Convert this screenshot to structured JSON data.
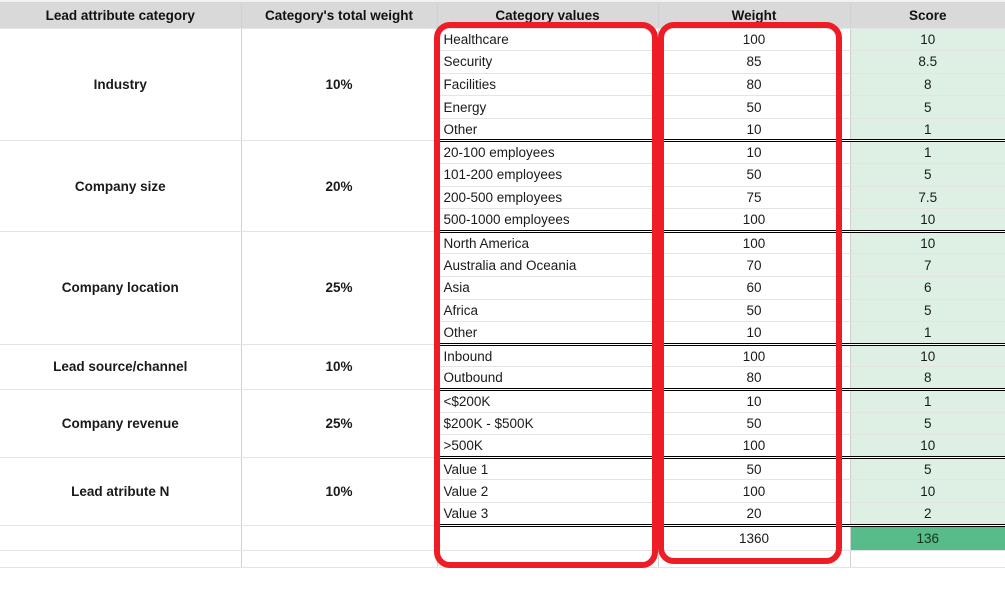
{
  "table": {
    "columns": [
      {
        "key": "category",
        "label": "Lead attribute category"
      },
      {
        "key": "weight_pct",
        "label": "Category's total weight"
      },
      {
        "key": "values",
        "label": "Category values"
      },
      {
        "key": "weight",
        "label": "Weight"
      },
      {
        "key": "score",
        "label": "Score"
      }
    ],
    "groups": [
      {
        "category": "Industry",
        "weight_pct": "10%",
        "rows": [
          {
            "value": "Healthcare",
            "weight": "100",
            "score": "10"
          },
          {
            "value": "Security",
            "weight": "85",
            "score": "8.5"
          },
          {
            "value": "Facilities",
            "weight": "80",
            "score": "8"
          },
          {
            "value": "Energy",
            "weight": "50",
            "score": "5"
          },
          {
            "value": "Other",
            "weight": "10",
            "score": "1"
          }
        ]
      },
      {
        "category": "Company size",
        "weight_pct": "20%",
        "rows": [
          {
            "value": "20-100 employees",
            "weight": "10",
            "score": "1"
          },
          {
            "value": "101-200 employees",
            "weight": "50",
            "score": "5"
          },
          {
            "value": "200-500 employees",
            "weight": "75",
            "score": "7.5"
          },
          {
            "value": "500-1000 employees",
            "weight": "100",
            "score": "10"
          }
        ]
      },
      {
        "category": "Company location",
        "weight_pct": "25%",
        "rows": [
          {
            "value": "North America",
            "weight": "100",
            "score": "10"
          },
          {
            "value": "Australia and Oceania",
            "weight": "70",
            "score": "7"
          },
          {
            "value": "Asia",
            "weight": "60",
            "score": "6"
          },
          {
            "value": "Africa",
            "weight": "50",
            "score": "5"
          },
          {
            "value": "Other",
            "weight": "10",
            "score": "1"
          }
        ]
      },
      {
        "category": "Lead source/channel",
        "weight_pct": "10%",
        "rows": [
          {
            "value": "Inbound",
            "weight": "100",
            "score": "10"
          },
          {
            "value": "Outbound",
            "weight": "80",
            "score": "8"
          }
        ]
      },
      {
        "category": "Company revenue",
        "weight_pct": "25%",
        "rows": [
          {
            "value": "<$200K",
            "weight": "10",
            "score": "1"
          },
          {
            "value": "$200K - $500K",
            "weight": "50",
            "score": "5"
          },
          {
            "value": ">500K",
            "weight": "100",
            "score": "10"
          }
        ]
      },
      {
        "category": "Lead atribute N",
        "weight_pct": "10%",
        "rows": [
          {
            "value": "Value 1",
            "weight": "50",
            "score": "5"
          },
          {
            "value": "Value 2",
            "weight": "100",
            "score": "10"
          },
          {
            "value": "Value 3",
            "weight": "20",
            "score": "2"
          }
        ]
      }
    ],
    "totals": {
      "category": "",
      "weight_pct": "",
      "value": "",
      "weight": "1360",
      "score": "136"
    }
  },
  "annotations": {
    "color": "#ee1c25",
    "boxes": [
      {
        "name": "category-values-highlight",
        "target": "Category values"
      },
      {
        "name": "weight-column-highlight",
        "target": "Weight"
      }
    ]
  },
  "colors": {
    "header_bg": "#d9d9d9",
    "score_bg": "#def0e4",
    "total_score_bg": "#57bb8a",
    "annotation_red": "#ee1c25",
    "grid_line": "#d0d0d0"
  }
}
